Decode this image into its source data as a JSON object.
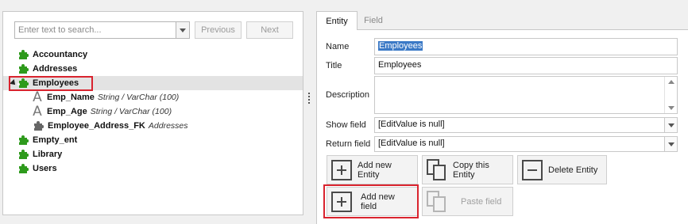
{
  "search": {
    "placeholder": "Enter text to search...",
    "prev_label": "Previous",
    "next_label": "Next"
  },
  "tree": {
    "items": [
      {
        "label": "Accountancy"
      },
      {
        "label": "Addresses"
      },
      {
        "label": "Employees"
      },
      {
        "label": "Emp_Name",
        "type": "String / VarChar (100)"
      },
      {
        "label": "Emp_Age",
        "type": "String / VarChar (100)"
      },
      {
        "label": "Employee_Address_FK",
        "type": "Addresses"
      },
      {
        "label": "Empty_ent"
      },
      {
        "label": "Library"
      },
      {
        "label": "Users"
      }
    ],
    "selected_index": 2
  },
  "tabs": {
    "entity_label": "Entity",
    "field_label": "Field"
  },
  "form": {
    "name_label": "Name",
    "name_value": "Employees",
    "title_label": "Title",
    "title_value": "Employees",
    "description_label": "Description",
    "description_value": "",
    "show_field_label": "Show field",
    "show_field_value": "[EditValue is null]",
    "return_field_label": "Return field",
    "return_field_value": "[EditValue is null]"
  },
  "actions": {
    "add_entity": "Add new Entity",
    "copy_entity": "Copy this Entity",
    "delete_entity": "Delete Entity",
    "add_field": "Add new field",
    "paste_field": "Paste field"
  },
  "colors": {
    "highlight_red": "#d9232e",
    "entity_green": "#2e9a1c",
    "selection_blue": "#3b79c6"
  },
  "icons": [
    "puzzle-icon",
    "text-field-icon",
    "foreign-key-icon",
    "add-icon",
    "copy-icon",
    "delete-icon",
    "paste-icon"
  ]
}
